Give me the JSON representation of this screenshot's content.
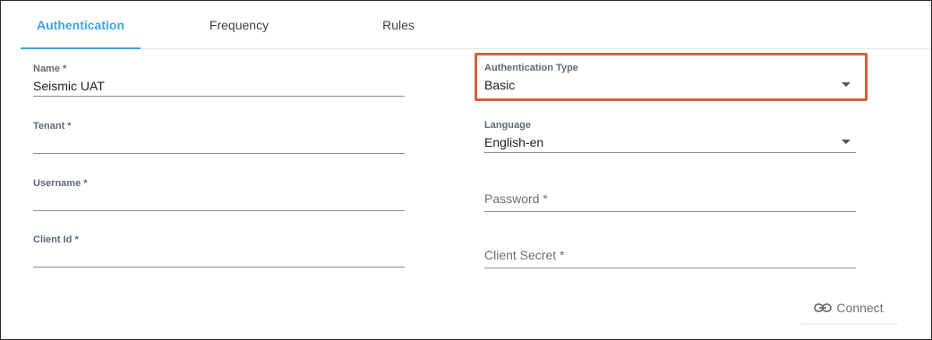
{
  "tabs": [
    {
      "label": "Authentication",
      "active": true
    },
    {
      "label": "Frequency",
      "active": false
    },
    {
      "label": "Rules",
      "active": false
    }
  ],
  "form": {
    "name": {
      "label": "Name *",
      "value": "Seismic UAT"
    },
    "tenant": {
      "label": "Tenant *",
      "value": ""
    },
    "username": {
      "label": "Username *",
      "value": ""
    },
    "client_id": {
      "label": "Client Id *",
      "value": ""
    },
    "auth_type": {
      "label": "Authentication Type",
      "value": "Basic"
    },
    "language": {
      "label": "Language",
      "value": "English-en"
    },
    "password": {
      "placeholder": "Password *"
    },
    "client_secret": {
      "placeholder": "Client Secret *"
    }
  },
  "actions": {
    "connect_label": "Connect",
    "connect_icon": "link-icon"
  },
  "colors": {
    "accent": "#38a6e0",
    "highlight": "#d35f3c"
  }
}
